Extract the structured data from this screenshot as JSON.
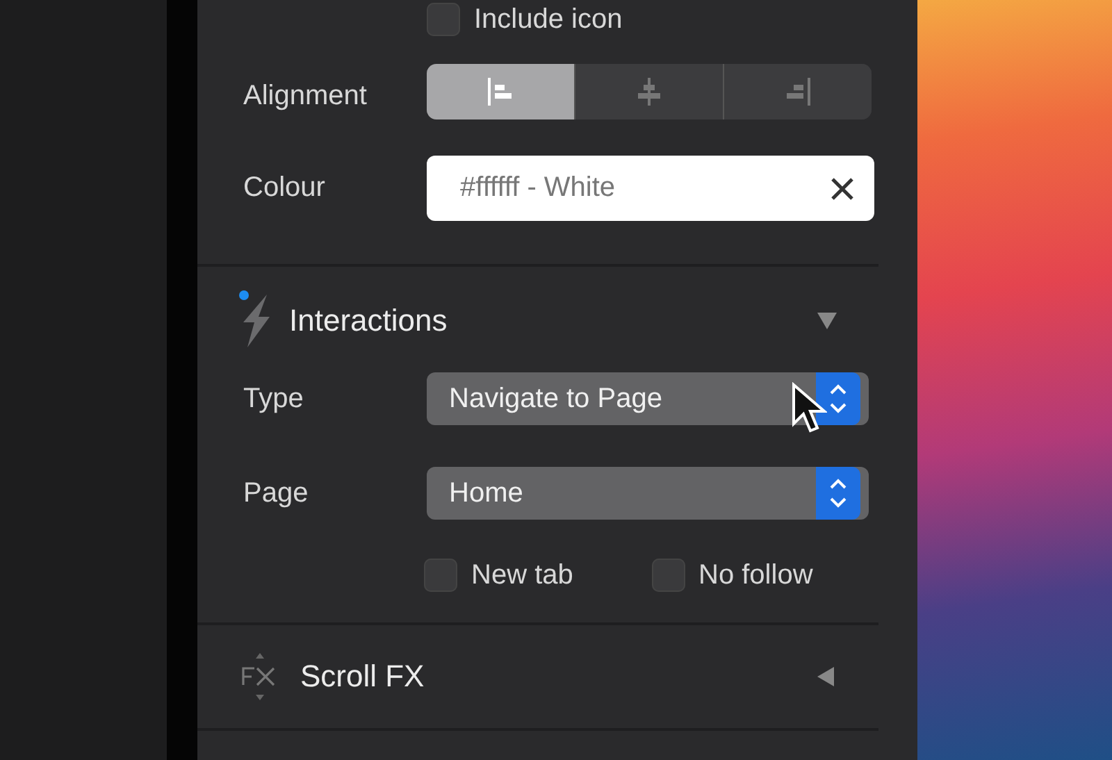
{
  "include_icon": {
    "label": "Include icon",
    "checked": false
  },
  "alignment": {
    "label": "Alignment",
    "options": [
      {
        "kind": "left",
        "selected": true
      },
      {
        "kind": "center",
        "selected": false
      },
      {
        "kind": "right",
        "selected": false
      }
    ]
  },
  "colour": {
    "label": "Colour",
    "value": "#ffffff - White"
  },
  "interactions": {
    "title": "Interactions",
    "expanded": true,
    "modified": true,
    "type": {
      "label": "Type",
      "value": "Navigate to Page"
    },
    "page": {
      "label": "Page",
      "value": "Home"
    },
    "options": [
      {
        "label": "New tab",
        "checked": false
      },
      {
        "label": "No follow",
        "checked": false
      }
    ]
  },
  "scroll_fx": {
    "title": "Scroll FX",
    "expanded": false
  }
}
